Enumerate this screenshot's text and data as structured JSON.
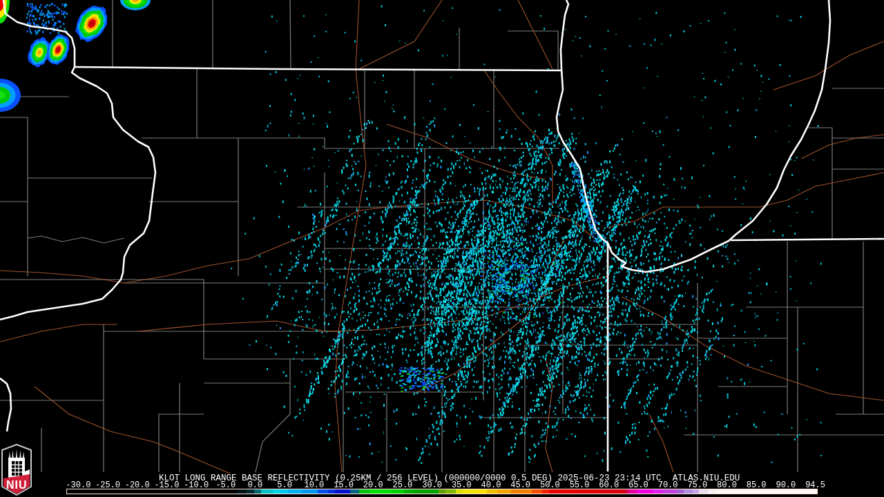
{
  "caption": {
    "title": "KLOT LONG RANGE BASE REFLECTIVITY (0.25KM / 256 LEVEL) (000000/0000 0.5 DEG) 2025-06-23 23:14 UTC",
    "source": "ATLAS.NIU.EDU"
  },
  "logo": {
    "text": "NIU"
  },
  "legend": {
    "ticks": [
      "-30.0",
      "-25.0",
      "-20.0",
      "-15.0",
      "-10.0",
      "-5.0",
      "0.0",
      "5.0",
      "10.0",
      "15.0",
      "20.0",
      "25.0",
      "30.0",
      "35.0",
      "40.0",
      "45.0",
      "50.0",
      "55.0",
      "60.0",
      "65.0",
      "70.0",
      "75.0",
      "80.0",
      "85.0",
      "90.0",
      "94.5"
    ]
  }
}
